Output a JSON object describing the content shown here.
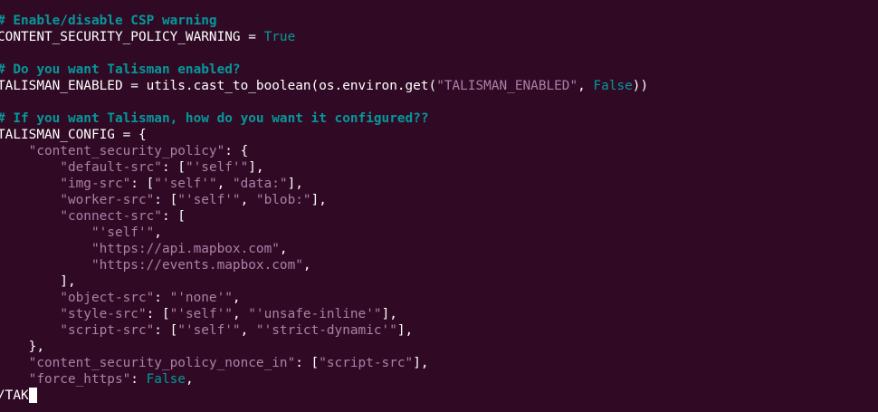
{
  "editor": {
    "lines": [
      [
        {
          "t": "# Enable/disable CSP warning",
          "c": "comment"
        }
      ],
      [
        {
          "t": "CONTENT_SECURITY_POLICY_WARNING = ",
          "c": "plain"
        },
        {
          "t": "True",
          "c": "const"
        }
      ],
      [],
      [
        {
          "t": "# Do you want Talisman enabled?",
          "c": "comment"
        }
      ],
      [
        {
          "t": "TALISMAN_ENABLED = utils.cast_to_boolean(os.environ.get(",
          "c": "plain"
        },
        {
          "t": "\"TALISMAN_ENABLED\"",
          "c": "string"
        },
        {
          "t": ", ",
          "c": "plain"
        },
        {
          "t": "False",
          "c": "const"
        },
        {
          "t": "))",
          "c": "plain"
        }
      ],
      [],
      [
        {
          "t": "# If you want Talisman, how do you want it configured??",
          "c": "comment"
        }
      ],
      [
        {
          "t": "TALISMAN_CONFIG = {",
          "c": "plain"
        }
      ],
      [
        {
          "t": "    ",
          "c": "plain"
        },
        {
          "t": "\"content_security_policy\"",
          "c": "string"
        },
        {
          "t": ": {",
          "c": "plain"
        }
      ],
      [
        {
          "t": "        ",
          "c": "plain"
        },
        {
          "t": "\"default-src\"",
          "c": "string"
        },
        {
          "t": ": [",
          "c": "plain"
        },
        {
          "t": "\"'self'\"",
          "c": "string"
        },
        {
          "t": "],",
          "c": "plain"
        }
      ],
      [
        {
          "t": "        ",
          "c": "plain"
        },
        {
          "t": "\"img-src\"",
          "c": "string"
        },
        {
          "t": ": [",
          "c": "plain"
        },
        {
          "t": "\"'self'\"",
          "c": "string"
        },
        {
          "t": ", ",
          "c": "plain"
        },
        {
          "t": "\"data:\"",
          "c": "string"
        },
        {
          "t": "],",
          "c": "plain"
        }
      ],
      [
        {
          "t": "        ",
          "c": "plain"
        },
        {
          "t": "\"worker-src\"",
          "c": "string"
        },
        {
          "t": ": [",
          "c": "plain"
        },
        {
          "t": "\"'self'\"",
          "c": "string"
        },
        {
          "t": ", ",
          "c": "plain"
        },
        {
          "t": "\"blob:\"",
          "c": "string"
        },
        {
          "t": "],",
          "c": "plain"
        }
      ],
      [
        {
          "t": "        ",
          "c": "plain"
        },
        {
          "t": "\"connect-src\"",
          "c": "string"
        },
        {
          "t": ": [",
          "c": "plain"
        }
      ],
      [
        {
          "t": "            ",
          "c": "plain"
        },
        {
          "t": "\"'self'\"",
          "c": "string"
        },
        {
          "t": ",",
          "c": "plain"
        }
      ],
      [
        {
          "t": "            ",
          "c": "plain"
        },
        {
          "t": "\"https://api.mapbox.com\"",
          "c": "string"
        },
        {
          "t": ",",
          "c": "plain"
        }
      ],
      [
        {
          "t": "            ",
          "c": "plain"
        },
        {
          "t": "\"https://events.mapbox.com\"",
          "c": "string"
        },
        {
          "t": ",",
          "c": "plain"
        }
      ],
      [
        {
          "t": "        ],",
          "c": "plain"
        }
      ],
      [
        {
          "t": "        ",
          "c": "plain"
        },
        {
          "t": "\"object-src\"",
          "c": "string"
        },
        {
          "t": ": ",
          "c": "plain"
        },
        {
          "t": "\"'none'\"",
          "c": "string"
        },
        {
          "t": ",",
          "c": "plain"
        }
      ],
      [
        {
          "t": "        ",
          "c": "plain"
        },
        {
          "t": "\"style-src\"",
          "c": "string"
        },
        {
          "t": ": [",
          "c": "plain"
        },
        {
          "t": "\"'self'\"",
          "c": "string"
        },
        {
          "t": ", ",
          "c": "plain"
        },
        {
          "t": "\"'unsafe-inline'\"",
          "c": "string"
        },
        {
          "t": "],",
          "c": "plain"
        }
      ],
      [
        {
          "t": "        ",
          "c": "plain"
        },
        {
          "t": "\"script-src\"",
          "c": "string"
        },
        {
          "t": ": [",
          "c": "plain"
        },
        {
          "t": "\"'self'\"",
          "c": "string"
        },
        {
          "t": ", ",
          "c": "plain"
        },
        {
          "t": "\"'strict-dynamic'\"",
          "c": "string"
        },
        {
          "t": "],",
          "c": "plain"
        }
      ],
      [
        {
          "t": "    },",
          "c": "plain"
        }
      ],
      [
        {
          "t": "    ",
          "c": "plain"
        },
        {
          "t": "\"content_security_policy_nonce_in\"",
          "c": "string"
        },
        {
          "t": ": [",
          "c": "plain"
        },
        {
          "t": "\"script-src\"",
          "c": "string"
        },
        {
          "t": "],",
          "c": "plain"
        }
      ],
      [
        {
          "t": "    ",
          "c": "plain"
        },
        {
          "t": "\"force_https\"",
          "c": "string"
        },
        {
          "t": ": ",
          "c": "plain"
        },
        {
          "t": "False",
          "c": "const"
        },
        {
          "t": ",",
          "c": "plain"
        }
      ]
    ],
    "command_line": "/TAK",
    "colors": {
      "background": "#300a24",
      "foreground": "#ffffff",
      "comment": "#06989a",
      "constant": "#06989a",
      "string": "#ad7fa8"
    }
  }
}
